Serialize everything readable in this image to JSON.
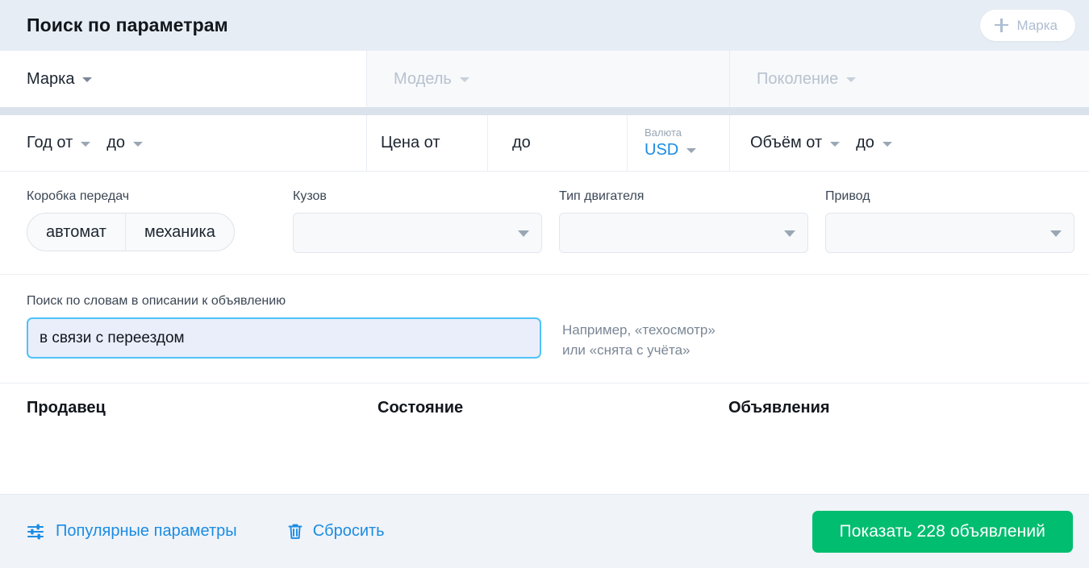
{
  "header": {
    "title": "Поиск по параметрам",
    "add_brand_label": "Марка",
    "add_brand_icon": "plus-icon"
  },
  "brand_row": [
    {
      "label": "Марка",
      "state": "active",
      "icon": "chevron-down-icon"
    },
    {
      "label": "Модель",
      "state": "disabled",
      "icon": "chevron-down-icon"
    },
    {
      "label": "Поколение",
      "state": "disabled",
      "icon": "chevron-down-icon"
    }
  ],
  "params_row": {
    "year": {
      "from_label": "Год от",
      "to_label": "до"
    },
    "price": {
      "from_label": "Цена от",
      "to_label": "до"
    },
    "currency": {
      "label": "Валюта",
      "value": "USD"
    },
    "volume": {
      "from_label": "Объём от",
      "to_label": "до"
    }
  },
  "selects_row": {
    "transmission": {
      "label": "Коробка передач",
      "options": [
        "автомат",
        "механика"
      ]
    },
    "body": {
      "label": "Кузов",
      "value": "",
      "icon": "chevron-down-icon"
    },
    "engine": {
      "label": "Тип двигателя",
      "value": "",
      "icon": "chevron-down-icon"
    },
    "drive": {
      "label": "Привод",
      "value": "",
      "icon": "chevron-down-icon"
    }
  },
  "keyword": {
    "label": "Поиск по словам в описании к объявлению",
    "value": "в связи с переездом",
    "placeholder": "",
    "hint_line1": "Например, «техосмотр»",
    "hint_line2": "или «снята с учёта»"
  },
  "group_headings": {
    "seller": "Продавец",
    "condition": "Состояние",
    "listings": "Объявления"
  },
  "footer": {
    "popular_params": "Популярные параметры",
    "popular_params_icon": "sliders-icon",
    "reset": "Сбросить",
    "reset_icon": "trash-icon",
    "submit": "Показать 228 объявлений"
  },
  "colors": {
    "accent_blue": "#1b8ce3",
    "submit_green": "#00bd6f",
    "focus_border": "#4fc3f7",
    "header_bg": "#e7edf4",
    "footer_bg": "#f0f3f8"
  }
}
